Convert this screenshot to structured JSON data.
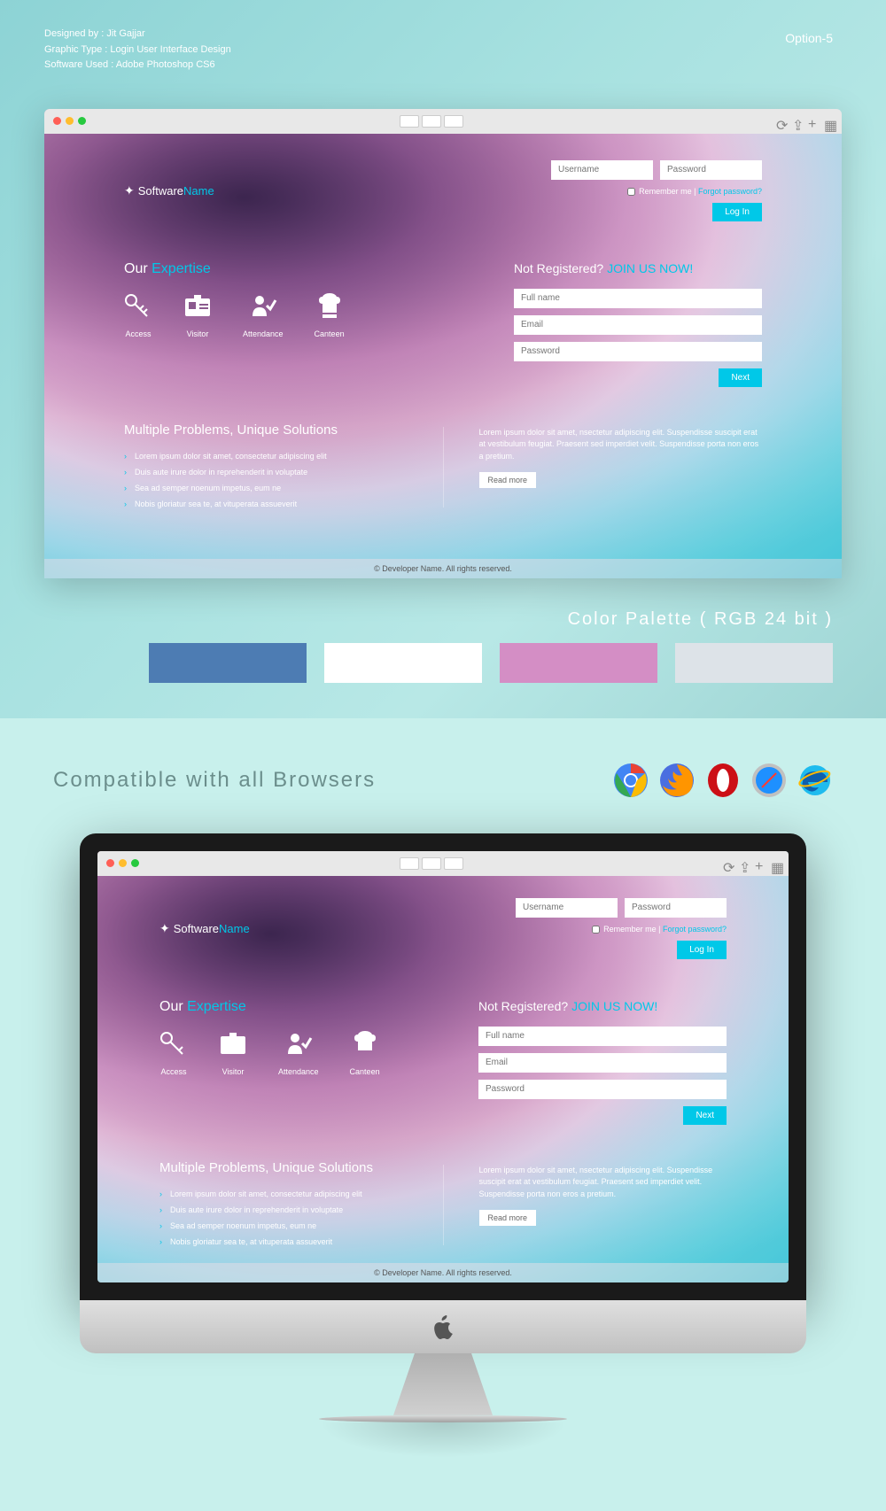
{
  "meta": {
    "designed": "Designed by : Jit Gajjar",
    "type": "Graphic Type : Login User Interface Design",
    "software": "Software Used : Adobe Photoshop CS6",
    "option": "Option-5"
  },
  "site": {
    "logo_prefix": "Software",
    "logo_suffix": "Name",
    "username_ph": "Username",
    "password_ph": "Password",
    "remember": "Remember me",
    "sep": " | ",
    "forgot": "Forgot password?",
    "login_btn": "Log In",
    "expertise_prefix": "Our ",
    "expertise_suffix": "Expertise",
    "features": {
      "access": "Access",
      "visitor": "Visitor",
      "attendance": "Attendance",
      "canteen": "Canteen"
    },
    "register_prefix": "Not Registered? ",
    "register_suffix": "JOIN US NOW!",
    "fullname_ph": "Full name",
    "email_ph": "Email",
    "pw2_ph": "Password",
    "next_btn": "Next",
    "problems_title": "Multiple Problems, Unique Solutions",
    "bullets": {
      "b1": "Lorem ipsum dolor sit amet, consectetur adipiscing elit",
      "b2": "Duis aute irure dolor in reprehenderit in voluptate",
      "b3": "Sea ad semper noenum impetus, eum ne",
      "b4": "Nobis gloriatur sea te, at vituperata assueverit"
    },
    "lorem": "Lorem ipsum dolor sit amet, nsectetur adipiscing elit. Suspendisse suscipit erat at vestibulum feugiat. Praesent sed imperdiet velit. Suspendisse porta non eros a pretium.",
    "read_more": "Read more",
    "footer": "© Developer Name. All rights reserved."
  },
  "palette": {
    "title": "Color Palette ( RGB 24 bit )",
    "c1": "#4d7cb3",
    "c2": "#ffffff",
    "c3": "#d48ec5",
    "c4": "#dde3e8"
  },
  "compat": {
    "title": "Compatible with all Browsers"
  }
}
